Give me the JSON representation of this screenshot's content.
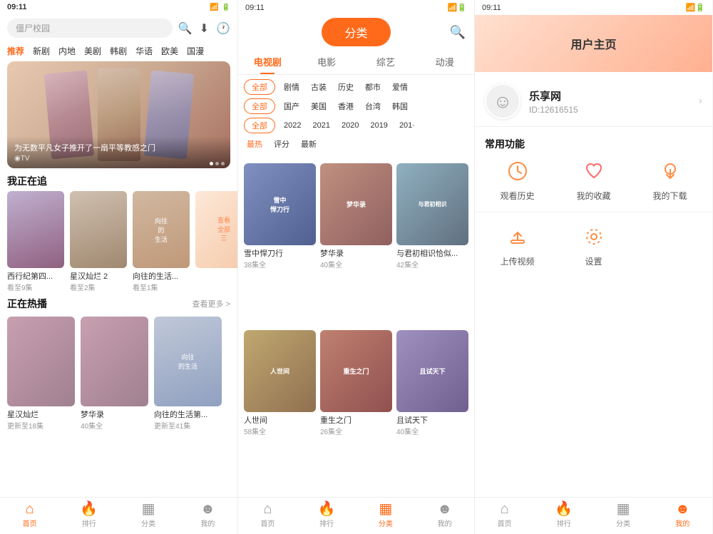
{
  "panel1": {
    "status_time": "09:11",
    "status_icons": "● ▲ ⊠ ①",
    "search_placeholder": "僵尸校园",
    "nav_items": [
      "推荐",
      "新剧",
      "内地",
      "美剧",
      "韩剧",
      "华语",
      "欧美",
      "国漫"
    ],
    "nav_active": "推荐",
    "banner_text": "为无数平凡女子推开了一扇平等教感之门",
    "banner_source": "◉TV",
    "section_tracking": "我正在追",
    "tracking_cards": [
      {
        "title": "西行纪第四...",
        "sub": "看至9集"
      },
      {
        "title": "星汉灿烂 2",
        "sub": "看至2集"
      },
      {
        "title": "向往的生活...",
        "sub": "看至1集"
      }
    ],
    "tracking_more": "查看全部三",
    "section_hotplay": "正在热播",
    "hotplay_more": "查看更多 >",
    "hotplay_cards": [
      {
        "title": "星汉灿烂",
        "sub": "更新至18集"
      },
      {
        "title": "梦华录",
        "sub": "40集全"
      },
      {
        "title": "向往的生活第...",
        "sub": "更新至41集"
      }
    ],
    "bottom_nav": [
      {
        "label": "首页",
        "icon": "⌂",
        "active": true
      },
      {
        "label": "排行",
        "icon": "🔥",
        "active": false
      },
      {
        "label": "分类",
        "icon": "▦",
        "active": false
      },
      {
        "label": "我的",
        "icon": "☻",
        "active": false
      }
    ]
  },
  "panel2": {
    "status_time": "09:11",
    "header_btn": "分类",
    "tabs": [
      "电视剧",
      "电影",
      "综艺",
      "动漫"
    ],
    "active_tab": "电视剧",
    "filter_rows": [
      {
        "chip": "全部",
        "items": [
          "剧情",
          "古装",
          "历史",
          "都市",
          "爱情"
        ]
      },
      {
        "chip": "全部",
        "items": [
          "国产",
          "美国",
          "香港",
          "台湾",
          "韩国"
        ]
      },
      {
        "chip": "全部",
        "items": [
          "2022",
          "2021",
          "2020",
          "2019",
          "201·"
        ]
      },
      {
        "chip": "最热",
        "items": [
          "评分",
          "最新"
        ]
      }
    ],
    "content_cards": [
      {
        "title": "雪中悍刀行",
        "sub": "38集全"
      },
      {
        "title": "梦华录",
        "sub": "40集全"
      },
      {
        "title": "与君初相识恰似...",
        "sub": "42集全"
      },
      {
        "title": "人世间",
        "sub": "58集全"
      },
      {
        "title": "重生之门",
        "sub": "26集全"
      },
      {
        "title": "且试天下",
        "sub": "40集全"
      }
    ],
    "bottom_nav": [
      {
        "label": "首页",
        "icon": "⌂",
        "active": false
      },
      {
        "label": "排行",
        "icon": "🔥",
        "active": false
      },
      {
        "label": "分类",
        "icon": "▦",
        "active": true
      },
      {
        "label": "我的",
        "icon": "☻",
        "active": false
      }
    ]
  },
  "panel3": {
    "status_time": "09:11",
    "page_title": "用户主页",
    "user_name": "乐享网",
    "user_id": "ID:12616515",
    "functions_title": "常用功能",
    "functions": [
      {
        "label": "观看历史",
        "icon": "🕐",
        "color": "ic-history"
      },
      {
        "label": "我的收藏",
        "icon": "♥",
        "color": "ic-collect"
      },
      {
        "label": "我的下载",
        "icon": "⬇",
        "color": "ic-download"
      },
      {
        "label": "上传视频",
        "icon": "⬆",
        "color": "ic-upload"
      },
      {
        "label": "设置",
        "icon": "◎",
        "color": "ic-settings"
      }
    ],
    "bottom_nav": [
      {
        "label": "首页",
        "icon": "⌂",
        "active": false
      },
      {
        "label": "排行",
        "icon": "🔥",
        "active": false
      },
      {
        "label": "分类",
        "icon": "▦",
        "active": false
      },
      {
        "label": "我的",
        "icon": "☻",
        "active": true
      }
    ]
  }
}
